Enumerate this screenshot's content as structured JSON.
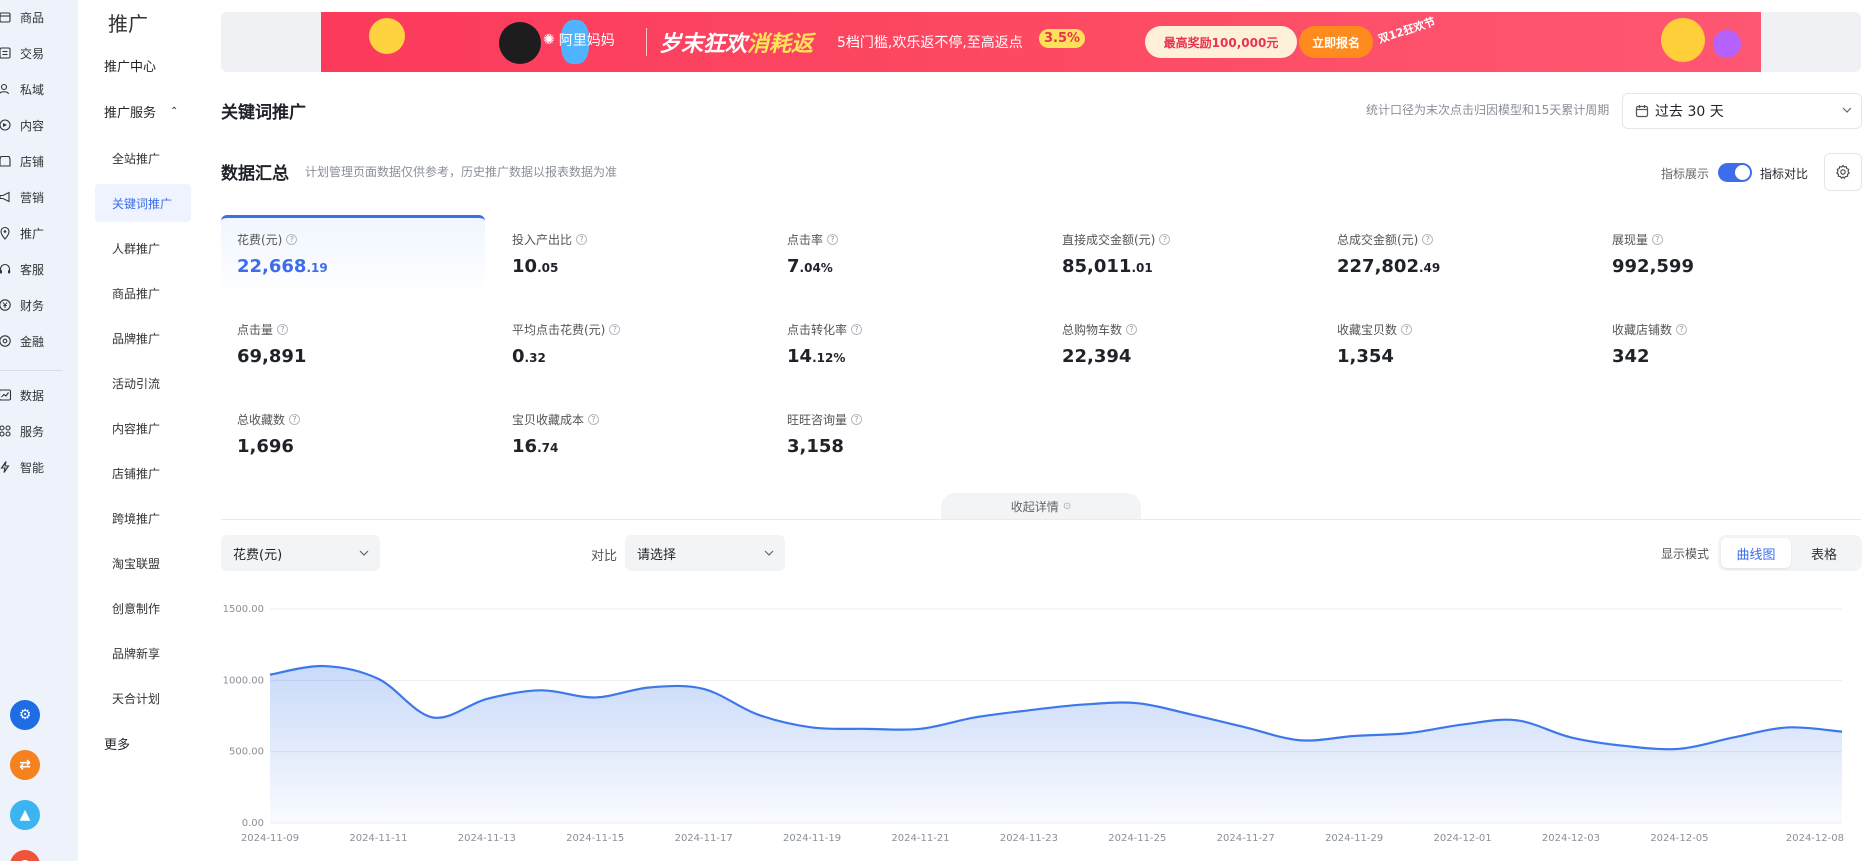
{
  "rail": {
    "items": [
      {
        "label": "商品",
        "icon": "box-icon"
      },
      {
        "label": "交易",
        "icon": "list-icon"
      },
      {
        "label": "私域",
        "icon": "users-icon"
      },
      {
        "label": "内容",
        "icon": "content-icon"
      },
      {
        "label": "店铺",
        "icon": "shop-icon"
      },
      {
        "label": "营销",
        "icon": "megaphone-icon"
      },
      {
        "label": "推广",
        "icon": "pin-icon"
      },
      {
        "label": "客服",
        "icon": "headset-icon"
      },
      {
        "label": "财务",
        "icon": "yuan-icon"
      },
      {
        "label": "金融",
        "icon": "finance-icon"
      }
    ],
    "items2": [
      {
        "label": "数据",
        "icon": "chart-icon"
      },
      {
        "label": "服务",
        "icon": "grid-icon"
      },
      {
        "label": "智能",
        "icon": "lightning-icon"
      }
    ]
  },
  "menu": {
    "title": "推广",
    "center": "推广中心",
    "group": "推广服务",
    "items": [
      "全站推广",
      "关键词推广",
      "人群推广",
      "商品推广",
      "品牌推广",
      "活动引流",
      "内容推广",
      "店铺推广",
      "跨境推广",
      "淘宝联盟",
      "创意制作",
      "品牌新享",
      "天合计划"
    ],
    "more": "更多"
  },
  "banner": {
    "logo": "阿里妈妈",
    "headline_a": "岁末狂欢",
    "headline_b": "消耗返",
    "sub": "5档门槛,欢乐返不停,至高返点",
    "pct": "3.5%",
    "reward": "最高奖励100,000元",
    "cta": "立即报名",
    "tag": "双12狂欢节"
  },
  "page": {
    "title": "关键词推广",
    "stat_note": "统计口径为末次点击归因模型和15天累计周期",
    "range": "过去 30 天"
  },
  "summary": {
    "title": "数据汇总",
    "note": "计划管理页面数据仅供参考，历史推广数据以报表数据为准",
    "toggle_label": "指标展示",
    "compare_label": "指标对比"
  },
  "metrics": [
    {
      "label": "花费(元)",
      "int": "22,668",
      "dec": ".19"
    },
    {
      "label": "投入产出比",
      "int": "10",
      "dec": ".05"
    },
    {
      "label": "点击率",
      "int": "7",
      "dec": ".04%"
    },
    {
      "label": "直接成交金额(元)",
      "int": "85,011",
      "dec": ".01"
    },
    {
      "label": "总成交金额(元)",
      "int": "227,802",
      "dec": ".49"
    },
    {
      "label": "展现量",
      "int": "992,599",
      "dec": ""
    },
    {
      "label": "点击量",
      "int": "69,891",
      "dec": ""
    },
    {
      "label": "平均点击花费(元)",
      "int": "0",
      "dec": ".32"
    },
    {
      "label": "点击转化率",
      "int": "14",
      "dec": ".12%"
    },
    {
      "label": "总购物车数",
      "int": "22,394",
      "dec": ""
    },
    {
      "label": "收藏宝贝数",
      "int": "1,354",
      "dec": ""
    },
    {
      "label": "收藏店铺数",
      "int": "342",
      "dec": ""
    },
    {
      "label": "总收藏数",
      "int": "1,696",
      "dec": ""
    },
    {
      "label": "宝贝收藏成本",
      "int": "16",
      "dec": ".74"
    },
    {
      "label": "旺旺咨询量",
      "int": "3,158",
      "dec": ""
    }
  ],
  "controls": {
    "collapse": "收起详情",
    "metric_select": "花费(元)",
    "compare": "对比",
    "compare_placeholder": "请选择",
    "mode_label": "显示模式",
    "mode_curve": "曲线图",
    "mode_table": "表格"
  },
  "colors": {
    "accent": "#3d6dea",
    "banner": "#fb3a5c"
  },
  "chart_data": {
    "type": "area",
    "yticks": [
      "1500.00",
      "1000.00",
      "500.00",
      "0.00"
    ],
    "ylim": [
      0,
      1500
    ],
    "xticks": [
      "2024-11-09",
      "2024-11-11",
      "2024-11-13",
      "2024-11-15",
      "2024-11-17",
      "2024-11-19",
      "2024-11-21",
      "2024-11-23",
      "2024-11-25",
      "2024-11-27",
      "2024-11-29",
      "2024-12-01",
      "2024-12-03",
      "2024-12-05",
      "2024-12-08"
    ],
    "x": [
      "2024-11-09",
      "2024-11-10",
      "2024-11-11",
      "2024-11-12",
      "2024-11-13",
      "2024-11-14",
      "2024-11-15",
      "2024-11-16",
      "2024-11-17",
      "2024-11-18",
      "2024-11-19",
      "2024-11-20",
      "2024-11-21",
      "2024-11-22",
      "2024-11-23",
      "2024-11-24",
      "2024-11-25",
      "2024-11-26",
      "2024-11-27",
      "2024-11-28",
      "2024-11-29",
      "2024-11-30",
      "2024-12-01",
      "2024-12-02",
      "2024-12-03",
      "2024-12-04",
      "2024-12-05",
      "2024-12-06",
      "2024-12-07",
      "2024-12-08"
    ],
    "series": [
      {
        "values": [
          1040,
          1100,
          1010,
          740,
          870,
          930,
          880,
          950,
          940,
          760,
          670,
          660,
          660,
          740,
          790,
          830,
          840,
          760,
          670,
          580,
          610,
          630,
          690,
          720,
          600,
          540,
          520,
          600,
          670,
          640
        ]
      }
    ],
    "color": "#3d78ea"
  }
}
